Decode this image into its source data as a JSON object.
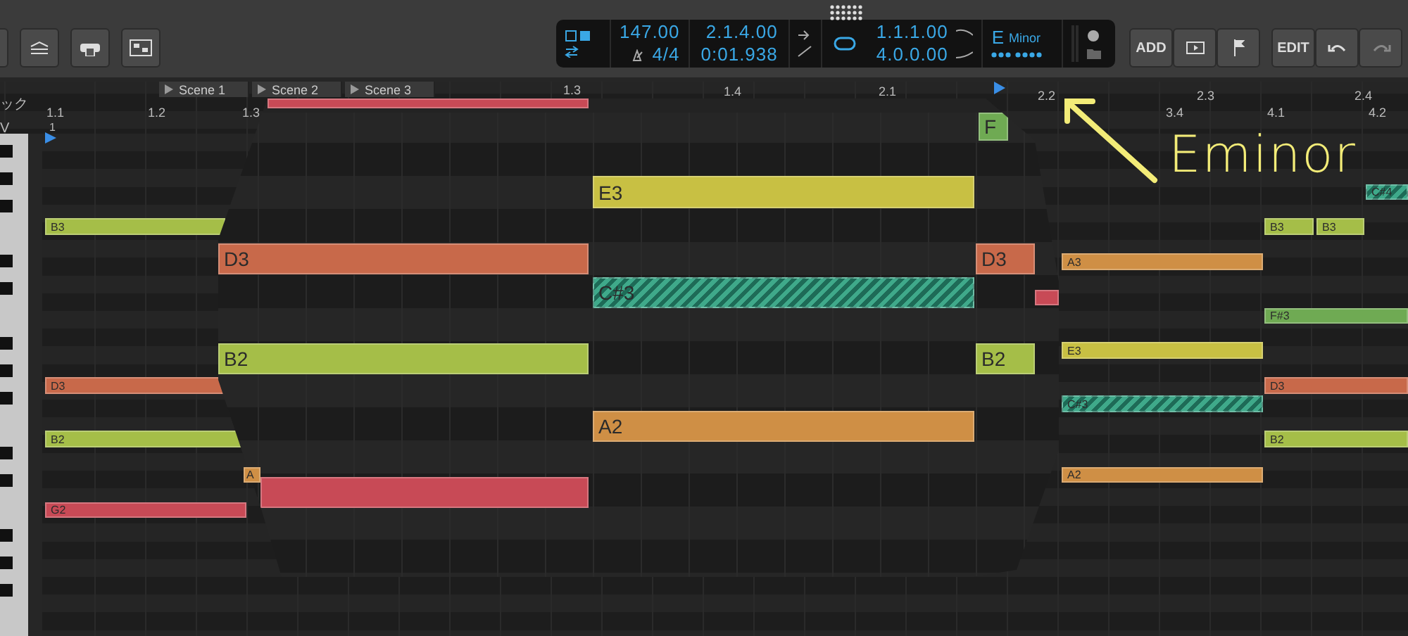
{
  "transport": {
    "tempo": "147.00",
    "time_signature": "4/4",
    "position_bars": "2.1.4.00",
    "position_time": "0:01.938",
    "loop_start": "1.1.1.00",
    "loop_length": "4.0.0.00",
    "key": "E",
    "scale": "Minor"
  },
  "buttons": [
    "ADD",
    "EDIT"
  ],
  "track_labels": [
    "ック",
    "V"
  ],
  "scenes": [
    "Scene 1",
    "Scene 2",
    "Scene 3"
  ],
  "ruler": [
    "1.1",
    "1.2",
    "1.3",
    "1.3",
    "1.4",
    "2.1",
    "2.2",
    "2.3",
    "2.4",
    "1",
    "3.4",
    "4.1",
    "4.2"
  ],
  "notes": [
    {
      "label": "B3",
      "color": "#a5be48",
      "hatched": false
    },
    {
      "label": "D3",
      "color": "#c8694a",
      "hatched": false
    },
    {
      "label": "B2",
      "color": "#a5be48",
      "hatched": false
    },
    {
      "label": "G2",
      "color": "#c84a56",
      "hatched": false
    },
    {
      "label": "A",
      "color": "#cf8f45",
      "hatched": false
    },
    {
      "label": "C#4",
      "color": "#3fa98a",
      "hatched": true
    },
    {
      "label": "B3",
      "color": "#a5be48",
      "hatched": false
    },
    {
      "label": "B3",
      "color": "#a5be48",
      "hatched": false
    },
    {
      "label": "A3",
      "color": "#cf8f45",
      "hatched": false
    },
    {
      "label": "F#3",
      "color": "#6faa53",
      "hatched": false
    },
    {
      "label": "E3",
      "color": "#c8c043",
      "hatched": false
    },
    {
      "label": "D3",
      "color": "#c8694a",
      "hatched": false
    },
    {
      "label": "C#3",
      "color": "#3fa98a",
      "hatched": true
    },
    {
      "label": "B2",
      "color": "#a5be48",
      "hatched": false
    },
    {
      "label": "A2",
      "color": "#cf8f45",
      "hatched": false
    }
  ],
  "lens_notes": [
    {
      "color": "#c84a56",
      "hatched": false
    },
    {
      "label": "E3",
      "color": "#c8c043",
      "hatched": false
    },
    {
      "label": "D3",
      "color": "#c8694a",
      "hatched": false
    },
    {
      "label": "C#3",
      "color": "#3fa98a",
      "hatched": true
    },
    {
      "label": "B2",
      "color": "#a5be48",
      "hatched": false
    },
    {
      "label": "A2",
      "color": "#cf8f45",
      "hatched": false
    },
    {
      "color": "#c84a56",
      "hatched": false
    },
    {
      "label": "F",
      "color": "#6faa53",
      "hatched": false
    },
    {
      "label": "D3",
      "color": "#c8694a",
      "hatched": false
    },
    {
      "label": "B2",
      "color": "#a5be48",
      "hatched": false
    },
    {
      "color": "#c84a56",
      "hatched": false
    }
  ],
  "annotation": "Eminor"
}
